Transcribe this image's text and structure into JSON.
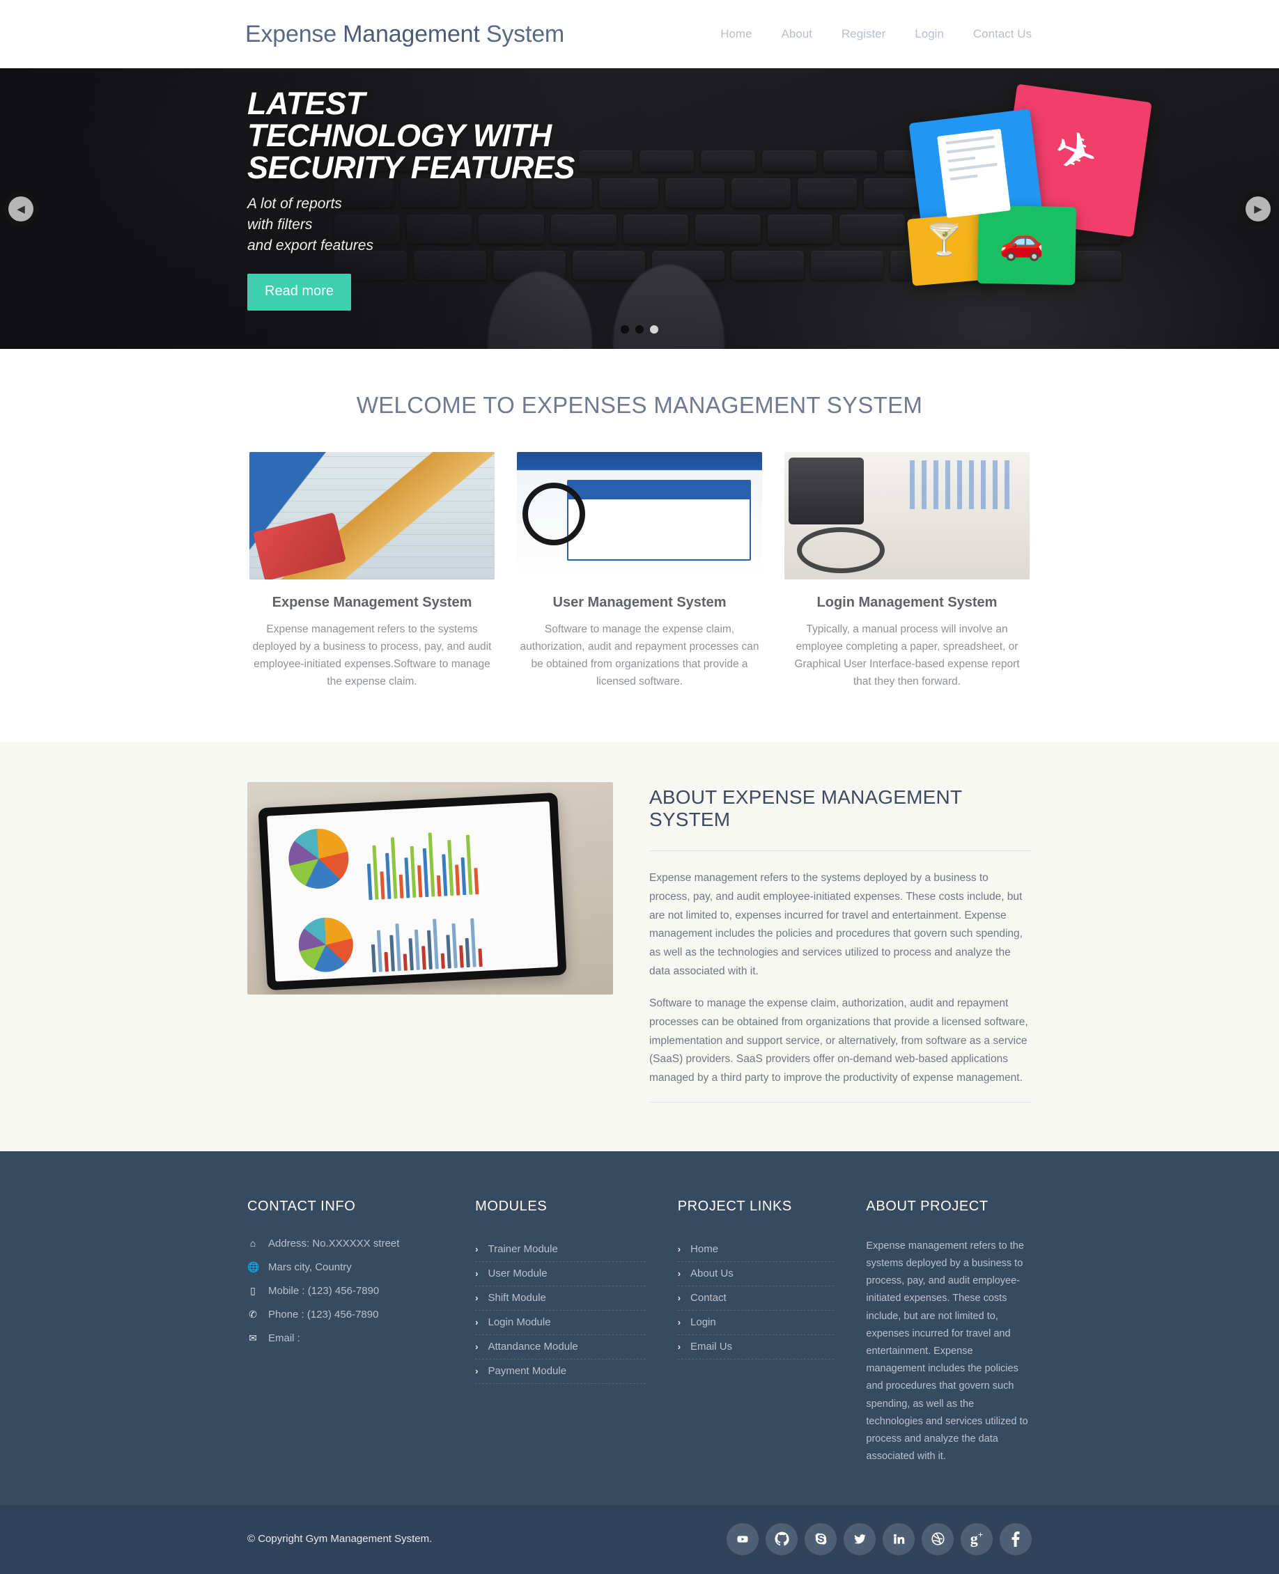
{
  "header": {
    "logo_part1": "Expense",
    "logo_part2": "Management",
    "logo_part3": "System",
    "nav": [
      {
        "label": "Home"
      },
      {
        "label": "About"
      },
      {
        "label": "Register"
      },
      {
        "label": "Login"
      },
      {
        "label": "Contact Us"
      }
    ]
  },
  "hero": {
    "title_line1": "LATEST",
    "title_line2": "TECHNOLOGY WITH",
    "title_line3": "SECURITY FEATURES",
    "sub_line1": "A lot of reports",
    "sub_line2": "with filters",
    "sub_line3": "and export features",
    "button_label": "Read more",
    "prev_icon": "chevron-left-icon",
    "next_icon": "chevron-right-icon",
    "dots": [
      {
        "active": false
      },
      {
        "active": false
      },
      {
        "active": true
      }
    ],
    "accent_color": "#3ecfaf",
    "background_color": "#1f1f1f"
  },
  "services": {
    "section_title": "WELCOME TO EXPENSES MANAGEMENT SYSTEM",
    "cards": [
      {
        "title": "Expense Management System",
        "text": "Expense management refers to the systems deployed by a business to process, pay, and audit employee-initiated expenses.Software to manage the expense claim."
      },
      {
        "title": "User Management System",
        "text": "Software to manage the expense claim, authorization, audit and repayment processes can be obtained from organizations that provide a licensed software."
      },
      {
        "title": "Login Management System",
        "text": "Typically, a manual process will involve an employee completing a paper, spreadsheet, or Graphical User Interface-based expense report that they then forward."
      }
    ]
  },
  "about": {
    "title": "ABOUT EXPENSE MANAGEMENT SYSTEM",
    "paragraph1": "Expense management refers to the systems deployed by a business to process, pay, and audit employee-initiated expenses. These costs include, but are not limited to, expenses incurred for travel and entertainment. Expense management includes the policies and procedures that govern such spending, as well as the technologies and services utilized to process and analyze the data associated with it.",
    "paragraph2": "Software to manage the expense claim, authorization, audit and repayment processes can be obtained from organizations that provide a licensed software, implementation and support service, or alternatively, from software as a service (SaaS) providers. SaaS providers offer on-demand web-based applications managed by a third party to improve the productivity of expense management.",
    "background_color": "#f7f8f2"
  },
  "footer": {
    "background_color": "#364a60",
    "contact": {
      "heading": "CONTACT INFO",
      "items": [
        {
          "icon": "home-icon",
          "text": "Address: No.XXXXXX street"
        },
        {
          "icon": "globe-icon",
          "text": "Mars city, Country"
        },
        {
          "icon": "mobile-icon",
          "text": "Mobile : (123) 456-7890"
        },
        {
          "icon": "phone-icon",
          "text": "Phone : (123) 456-7890"
        },
        {
          "icon": "envelope-icon",
          "text": "Email :"
        }
      ]
    },
    "modules": {
      "heading": "MODULES",
      "items": [
        {
          "label": "Trainer Module"
        },
        {
          "label": "User Module"
        },
        {
          "label": "Shift Module"
        },
        {
          "label": "Login Module"
        },
        {
          "label": "Attandance Module"
        },
        {
          "label": "Payment Module"
        }
      ]
    },
    "links": {
      "heading": "PROJECT LINKS",
      "items": [
        {
          "label": "Home"
        },
        {
          "label": "About Us"
        },
        {
          "label": "Contact"
        },
        {
          "label": "Login"
        },
        {
          "label": "Email Us"
        }
      ]
    },
    "about_project": {
      "heading": "ABOUT PROJECT",
      "text": "Expense management refers to the systems deployed by a business to process, pay, and audit employee-initiated expenses. These costs include, but are not limited to, expenses incurred for travel and entertainment. Expense management includes the policies and procedures that govern such spending, as well as the technologies and services utilized to process and analyze the data associated with it."
    },
    "bottom": {
      "copyright": "© Copyright Gym Management System.",
      "socials": [
        {
          "name": "youtube-icon"
        },
        {
          "name": "github-icon"
        },
        {
          "name": "skype-icon"
        },
        {
          "name": "twitter-icon"
        },
        {
          "name": "linkedin-icon"
        },
        {
          "name": "dribbble-icon"
        },
        {
          "name": "googleplus-icon"
        },
        {
          "name": "facebook-icon"
        }
      ]
    }
  }
}
